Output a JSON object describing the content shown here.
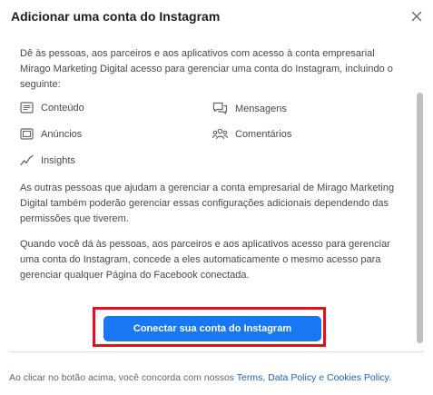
{
  "dialog": {
    "title": "Adicionar uma conta do Instagram",
    "close_label": "×"
  },
  "intro": "Dê às pessoas, aos parceiros e aos aplicativos com acesso à conta empresarial Mirago Marketing Digital acesso para gerenciar uma conta do Instagram, incluindo o seguinte:",
  "permissions": [
    {
      "label": "Conteúdo",
      "icon": "content-icon"
    },
    {
      "label": "Mensagens",
      "icon": "messages-icon"
    },
    {
      "label": "Anúncios",
      "icon": "ads-icon"
    },
    {
      "label": "Comentários",
      "icon": "comments-icon"
    },
    {
      "label": "Insights",
      "icon": "insights-icon"
    }
  ],
  "paragraph2": "As outras pessoas que ajudam a gerenciar a conta empresarial de Mirago Marketing Digital também poderão gerenciar essas configurações adicionais dependendo das permissões que tiverem.",
  "paragraph3": "Quando você dá às pessoas, aos parceiros e aos aplicativos acesso para gerenciar uma conta do Instagram, concede a eles automaticamente o mesmo acesso para gerenciar qualquer Página do Facebook conectada.",
  "primary_button": "Conectar sua conta do Instagram",
  "footer": {
    "prefix": "Ao clicar no botão acima, você concorda com nossos ",
    "terms": "Terms",
    "sep1": ", ",
    "data_policy": "Data Policy",
    "sep2": " e ",
    "cookies": "Cookies Policy",
    "suffix": "."
  },
  "colors": {
    "primary": "#1877f2",
    "highlight": "#e0131d",
    "link": "#1a5fc9"
  }
}
